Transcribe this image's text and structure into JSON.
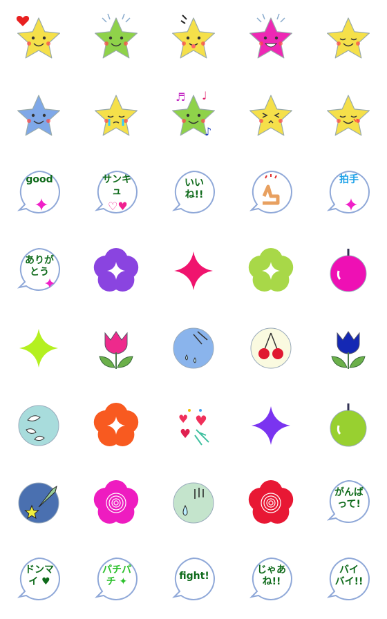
{
  "items": [
    {
      "kind": "star",
      "fill": "#f5e04a",
      "face": "smile",
      "extra": "heart"
    },
    {
      "kind": "star",
      "fill": "#8fd24a",
      "face": "smile",
      "extra": "rays"
    },
    {
      "kind": "star",
      "fill": "#f5e04a",
      "face": "tongue",
      "extra": "lines"
    },
    {
      "kind": "star",
      "fill": "#ee28b4",
      "face": "grin",
      "extra": "rays"
    },
    {
      "kind": "star",
      "fill": "#f5e04a",
      "face": "sleepy",
      "extra": ""
    },
    {
      "kind": "star",
      "fill": "#7fa8e8",
      "face": "smile",
      "extra": ""
    },
    {
      "kind": "star",
      "fill": "#f5e04a",
      "face": "cry",
      "extra": ""
    },
    {
      "kind": "star",
      "fill": "#8fd24a",
      "face": "smile",
      "extra": "notes"
    },
    {
      "kind": "star",
      "fill": "#f5e04a",
      "face": "squint",
      "extra": ""
    },
    {
      "kind": "star",
      "fill": "#f5e04a",
      "face": "sleepy",
      "extra": "blush"
    },
    {
      "kind": "bubble",
      "lines": [
        "good"
      ],
      "color": "#0e6a1a",
      "deco": "sparkle"
    },
    {
      "kind": "bubble",
      "lines": [
        "サンキュ"
      ],
      "color": "#0e6a1a",
      "deco": "hearts"
    },
    {
      "kind": "bubble",
      "lines": [
        "いい",
        "ね!!"
      ],
      "color": "#0e6a1a",
      "deco": ""
    },
    {
      "kind": "bubble",
      "lines": [],
      "color": "#e8a060",
      "deco": "thumb"
    },
    {
      "kind": "bubble",
      "lines": [
        "拍手"
      ],
      "color": "#1aa0e8",
      "deco": "sparkle"
    },
    {
      "kind": "bubble",
      "lines": [
        "ありが",
        "とう"
      ],
      "color": "#0e6a1a",
      "deco": "sparkle-small"
    },
    {
      "kind": "flower",
      "fill": "#8a44e0",
      "inner": "sparkle"
    },
    {
      "kind": "sparkle",
      "fill": "#f0146e"
    },
    {
      "kind": "flower",
      "fill": "#a8d848",
      "inner": "sparkle"
    },
    {
      "kind": "apple",
      "fill": "#ee10b4"
    },
    {
      "kind": "sparkle",
      "fill": "#b4f020"
    },
    {
      "kind": "tulip",
      "fill": "#ee2a8c"
    },
    {
      "kind": "circle",
      "fill": "#8ab4ec",
      "inner": "rain"
    },
    {
      "kind": "circle",
      "fill": "#fafae0",
      "inner": "cherry"
    },
    {
      "kind": "tulip",
      "fill": "#1428b4"
    },
    {
      "kind": "circle",
      "fill": "#a8dcdc",
      "inner": "splash"
    },
    {
      "kind": "flower",
      "fill": "#f85a20",
      "inner": "sparkle"
    },
    {
      "kind": "confetti",
      "fill": "#f0305a"
    },
    {
      "kind": "sparkle",
      "fill": "#7a34f0"
    },
    {
      "kind": "apple",
      "fill": "#98d030"
    },
    {
      "kind": "circle",
      "fill": "#4a70b0",
      "inner": "shooting"
    },
    {
      "kind": "flower",
      "fill": "#ee1cc0",
      "inner": "swirl"
    },
    {
      "kind": "circle",
      "fill": "#c4e4cc",
      "inner": "drop"
    },
    {
      "kind": "flower",
      "fill": "#e81834",
      "inner": "swirl"
    },
    {
      "kind": "bubble",
      "lines": [
        "がんば",
        "って!"
      ],
      "color": "#0e6a1a",
      "deco": ""
    },
    {
      "kind": "bubble",
      "lines": [
        "ドンマ",
        "イ ♥"
      ],
      "color": "#0e6a1a",
      "deco": ""
    },
    {
      "kind": "bubble",
      "lines": [
        "パチパ",
        "チ ✦"
      ],
      "color": "#2ac02a",
      "deco": ""
    },
    {
      "kind": "bubble",
      "lines": [
        "fight!"
      ],
      "color": "#0e6a1a",
      "deco": ""
    },
    {
      "kind": "bubble",
      "lines": [
        "じゃあ",
        "ね!!"
      ],
      "color": "#0e6a1a",
      "deco": ""
    },
    {
      "kind": "bubble",
      "lines": [
        "バイ",
        "バイ!!"
      ],
      "color": "#0e6a1a",
      "deco": ""
    }
  ]
}
